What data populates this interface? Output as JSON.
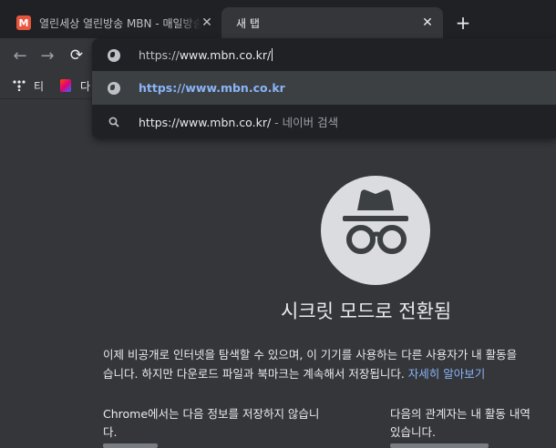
{
  "tabs": [
    {
      "favicon_letter": "M",
      "title": "열린세상 열린방송 MBN - 매일방송",
      "close": "✕"
    },
    {
      "title": "새 탭",
      "close": "✕"
    }
  ],
  "new_tab_glyph": "+",
  "nav": {
    "back": "←",
    "forward": "→",
    "reload": "⟳"
  },
  "bookmarks": [
    {
      "label": "티"
    },
    {
      "label": "다"
    }
  ],
  "omnibox": {
    "typed_prefix": "https://",
    "typed_rest": "www.mbn.co.kr/",
    "suggestions": [
      {
        "text": "https://www.mbn.co.kr"
      },
      {
        "text": "https://www.mbn.co.kr/",
        "separator": " - ",
        "provider": "네이버 검색"
      }
    ]
  },
  "incognito": {
    "heading": "시크릿 모드로 전환됨",
    "para_line1": "이제 비공개로 인터넷을 탐색할 수 있으며, 이 기기를 사용하는 다른 사용자가 내 활동을",
    "para_line2": "습니다. 하지만 다운로드 파일과 북마크는 계속해서 저장됩니다.",
    "learn_more": "자세히 알아보기",
    "col1_line1": "Chrome에서는 다음 정보를 저장하지 않습니",
    "col1_line2": "다.",
    "col2_line1": "다음의 관계자는 내 활동 내역",
    "col2_line2": "있습니다."
  }
}
